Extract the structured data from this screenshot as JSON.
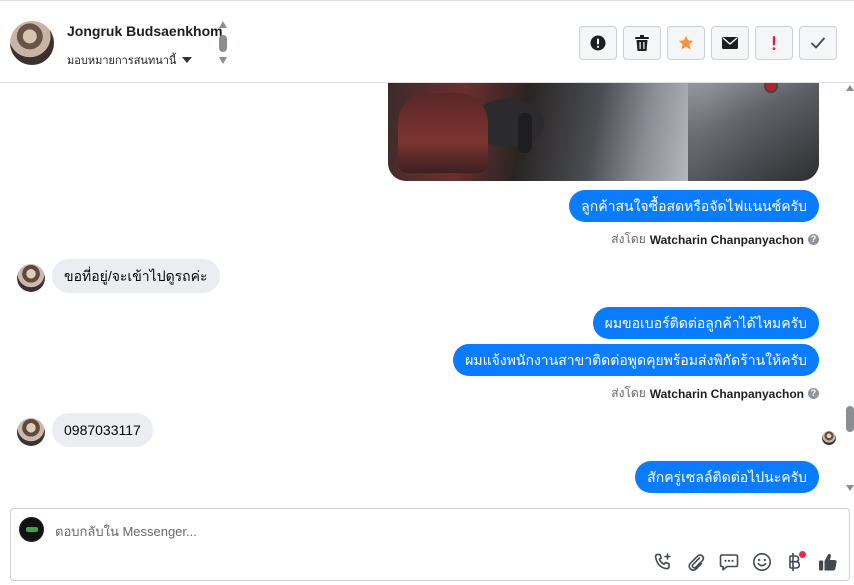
{
  "header": {
    "contact_name": "Jongruk Budsaenkhom",
    "assign_label": "มอบหมายการสนทนานี้",
    "actions": [
      {
        "icon": "alert-circle-icon",
        "color": "#1c1e21"
      },
      {
        "icon": "trash-icon",
        "color": "#1c1e21"
      },
      {
        "icon": "star-icon",
        "color": "#f7923a"
      },
      {
        "icon": "envelope-icon",
        "color": "#1c1e21"
      },
      {
        "icon": "exclamation-icon",
        "color": "#e41e3f"
      },
      {
        "icon": "checkmark-icon",
        "color": "#1c1e21"
      }
    ]
  },
  "messages": {
    "m1": "ลูกค้าสนใจซื้อสดหรือจัดไฟแนนซ์ครับ",
    "sent1_prefix": "ส่งโดย",
    "sent1_name": "Watcharin Chanpanyachon",
    "m2": "ขอที่อยู่/จะเข้าไปดูรถค่ะ",
    "m3": "ผมขอเบอร์ติดต่อลูกค้าได้ไหมครับ",
    "m4": "ผมแจ้งพนักงานสาขาติดต่อพูดคุยพร้อมส่งพิกัดร้านให้ครับ",
    "sent2_prefix": "ส่งโดย",
    "sent2_name": "Watcharin Chanpanyachon",
    "m5": "0987033117",
    "m6": "สักครู่เซลล์ติดต่อไปนะครับ"
  },
  "colors": {
    "outgoing_bubble": "#0a7cff",
    "incoming_bubble": "#ebedf0",
    "accent_star": "#f7923a",
    "alert_red": "#e41e3f"
  },
  "composer": {
    "placeholder": "ตอบกลับใน Messenger...",
    "tools": [
      "call-add-icon",
      "paperclip-icon",
      "chat-bubble-icon",
      "smiley-icon",
      "baht-icon",
      "thumbs-up-icon"
    ]
  }
}
